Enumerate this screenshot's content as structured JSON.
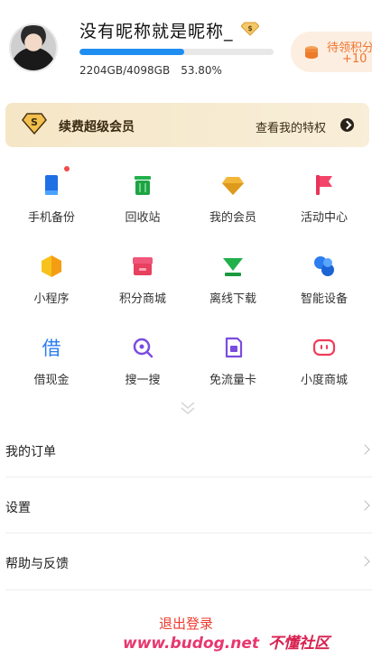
{
  "profile": {
    "nickname": "没有昵称就是昵称_",
    "storage_used": "2204GB/4098GB",
    "storage_percent": "53.80%",
    "storage_fraction": 0.538
  },
  "points": {
    "label": "待领积分",
    "value": "+10"
  },
  "vip": {
    "title": "续费超级会员",
    "privilege": "查看我的特权"
  },
  "grid": [
    {
      "label": "手机备份",
      "icon": "phone-backup-icon"
    },
    {
      "label": "回收站",
      "icon": "recycle-bin-icon"
    },
    {
      "label": "我的会员",
      "icon": "diamond-icon"
    },
    {
      "label": "活动中心",
      "icon": "flag-icon"
    },
    {
      "label": "小程序",
      "icon": "mini-program-icon"
    },
    {
      "label": "积分商城",
      "icon": "store-icon"
    },
    {
      "label": "离线下载",
      "icon": "download-icon"
    },
    {
      "label": "智能设备",
      "icon": "smart-device-icon"
    },
    {
      "label": "借现金",
      "icon": "borrow-cash-icon"
    },
    {
      "label": "搜一搜",
      "icon": "search-icon"
    },
    {
      "label": "免流量卡",
      "icon": "sim-card-icon"
    },
    {
      "label": "小度商城",
      "icon": "xiaodu-icon"
    }
  ],
  "menu": [
    {
      "label": "我的订单"
    },
    {
      "label": "设置"
    },
    {
      "label": "帮助与反馈"
    }
  ],
  "logout_label": "退出登录",
  "watermark": {
    "url": "www.budog.net",
    "name": "不懂社区"
  },
  "colors": {
    "accent": "#1f8ef1",
    "points": "#f0742b",
    "logout": "#ef3b2e",
    "vip_bg": "#f5e6c6"
  }
}
